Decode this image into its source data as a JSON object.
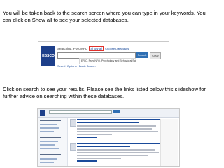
{
  "instructions": {
    "paragraph1": "You will be taken back to the search screen where you can type in your keywords.  You can click on Show all to see your selected databases.",
    "paragraph2": "Click on search to see your results. Please see the links listed below this slideshow for further advice on searching within these databases."
  },
  "search_screen": {
    "logo_text": "EBSCO",
    "searching_label": "Searching: PsycINFO",
    "show_all_label": "Show all",
    "choose_databases_label": "Choose Databases",
    "database_dropdown": "ERIC, PsycINFO, Psychology and Behavioral Sciences",
    "search_button_label": "Search",
    "clear_button_label": "Clear",
    "search_options_label": "Search Options",
    "basic_search_label": "Basic Search"
  },
  "colors": {
    "ebsco_blue": "#1d3f8a",
    "link_blue": "#1a4a9a",
    "search_button": "#2f6fb3",
    "highlight_red": "#e0302a"
  }
}
